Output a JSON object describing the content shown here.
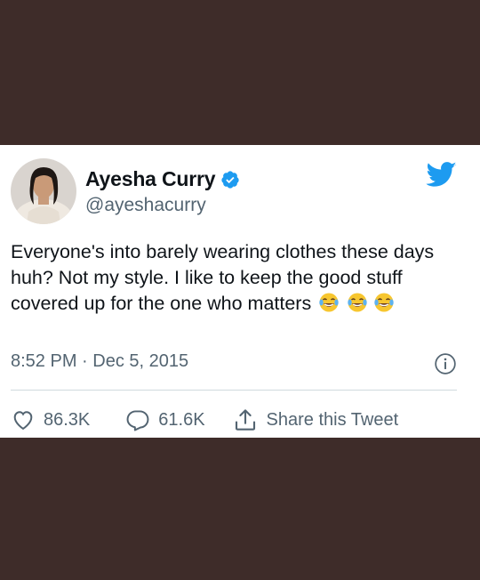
{
  "tweet": {
    "display_name": "Ayesha Curry",
    "handle": "@ayeshacurry",
    "text": "Everyone's into barely wearing clothes these days huh? Not my style. I like to keep the good stuff covered up for the one who matters",
    "emojis": [
      "face-with-tears-of-joy",
      "face-with-tears-of-joy",
      "face-with-tears-of-joy"
    ],
    "timestamp": "8:52 PM · Dec 5, 2015",
    "verified": true
  },
  "actions": {
    "likes": "86.3K",
    "replies": "61.6K",
    "share_label": "Share this Tweet"
  },
  "icons": {
    "verified": "verified-badge-icon",
    "logo": "twitter-bird-icon",
    "info": "info-icon",
    "like": "heart-icon",
    "reply": "reply-bubble-icon",
    "share": "share-icon"
  },
  "colors": {
    "background": "#3e2c29",
    "card": "#ffffff",
    "text": "#0f1419",
    "secondary_text": "#536471",
    "twitter_blue": "#1d9bf0",
    "divider": "#cfd9de"
  }
}
